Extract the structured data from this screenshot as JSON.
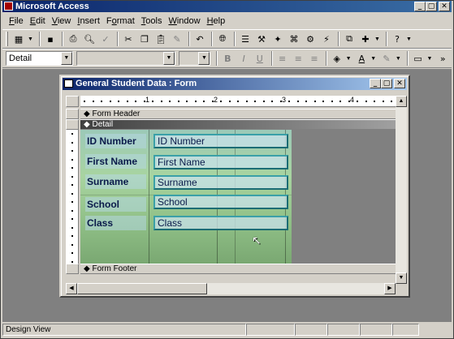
{
  "app": {
    "title": "Microsoft Access"
  },
  "window_buttons": {
    "minimize": "_",
    "restore": "▢",
    "close": "✕"
  },
  "menu": [
    "File",
    "Edit",
    "View",
    "Insert",
    "Format",
    "Tools",
    "Window",
    "Help"
  ],
  "menu_access_keys": [
    "F",
    "E",
    "V",
    "I",
    "o",
    "T",
    "W",
    "H"
  ],
  "toolbar1": {
    "icons": [
      "form-view-icon",
      "save-icon",
      "print-icon",
      "print-preview-icon",
      "spelling-icon",
      "cut-icon",
      "copy-icon",
      "paste-icon",
      "format-painter-icon",
      "undo-icon",
      "insert-hyperlink-icon",
      "field-list-icon",
      "toolbox-icon",
      "autoformat-icon",
      "code-icon",
      "properties-icon",
      "build-icon",
      "database-window-icon",
      "new-object-icon",
      "help-icon"
    ]
  },
  "toolbar2": {
    "object_combo": "Detail",
    "font_combo": "",
    "size_combo": "",
    "bold": "B",
    "italic": "I",
    "underline": "U",
    "overflow": "»"
  },
  "form_window": {
    "title": "General Student Data : Form",
    "ruler_numbers": [
      "1",
      "2",
      "3",
      "4"
    ],
    "sections": {
      "header": "Form Header",
      "detail": "Detail",
      "footer": "Form Footer"
    },
    "fields": [
      {
        "label": "ID Number",
        "textbox": "ID Number"
      },
      {
        "label": "First Name",
        "textbox": "First Name"
      },
      {
        "label": "Surname",
        "textbox": "Surname"
      },
      {
        "label": "School",
        "textbox": "School"
      },
      {
        "label": "Class",
        "textbox": "Class"
      }
    ]
  },
  "status": {
    "text": "Design View"
  }
}
